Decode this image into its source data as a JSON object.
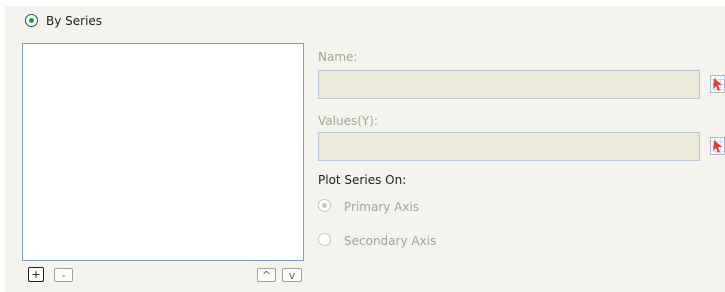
{
  "series_mode": {
    "label": "By Series"
  },
  "series_fields": {
    "name_label": "Name:",
    "name_value": "",
    "values_label": "Values(Y):",
    "values_value": ""
  },
  "plot_series": {
    "title": "Plot Series On:",
    "primary_axis_label": "Primary Axis",
    "secondary_axis_label": "Secondary Axis"
  },
  "list_controls": {
    "add_symbol": "+",
    "remove_symbol": "-",
    "up_symbol": "^",
    "down_symbol": "v"
  },
  "icons": {
    "selected_radio": "radio-selected-icon",
    "reference_picker": "cell-reference-icon"
  },
  "colors": {
    "panel_background": "#f4f3ee",
    "field_background": "#ece9d8",
    "accent_green": "#21a121",
    "list_border": "#7f9db9"
  }
}
